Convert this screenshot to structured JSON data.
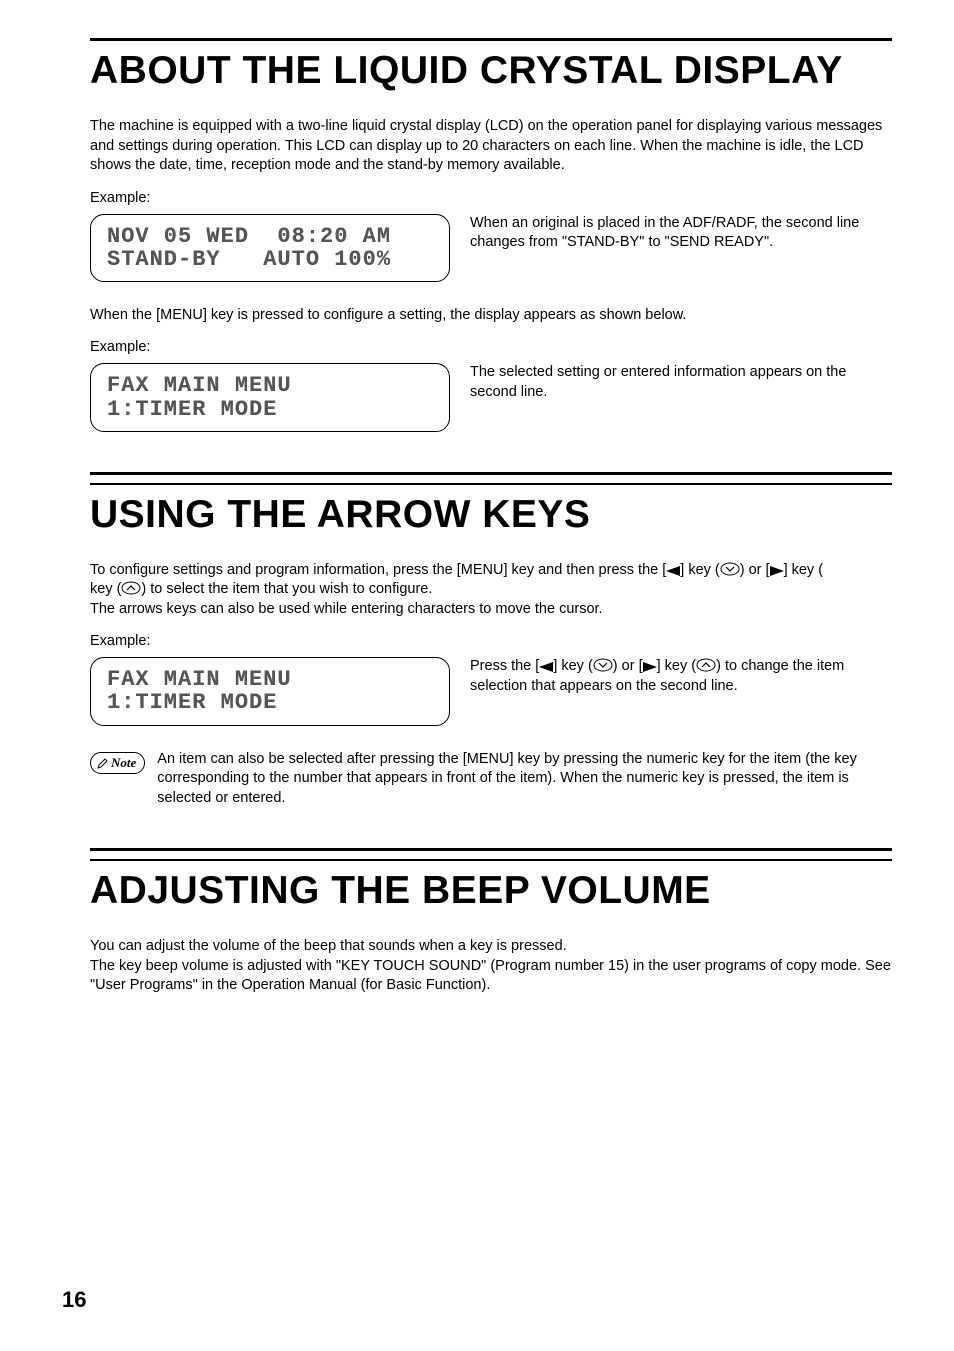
{
  "sections": [
    {
      "title": "ABOUT THE LIQUID CRYSTAL DISPLAY",
      "intro": "The machine is equipped with a two-line liquid crystal display (LCD) on the operation panel for displaying various messages and settings during operation. This LCD can display up to 20 characters on each line. When the machine is idle, the LCD shows the date, time, reception mode and the stand-by memory available.",
      "example_label": "Example:",
      "lcd1_line1": "NOV 05 WED  08:20 AM",
      "lcd1_line2": "STAND-BY   AUTO 100%",
      "lcd1_side": "When an original is placed in the ADF/RADF, the second line changes from \"STAND-BY\" to \"SEND READY\".",
      "mid_para": "When the [MENU] key is pressed to configure a setting, the display appears as shown below.",
      "lcd2_line1": "FAX MAIN MENU",
      "lcd2_line2": "1:TIMER MODE",
      "lcd2_side": "The selected setting or entered information appears on the second line."
    },
    {
      "title": "USING THE ARROW KEYS",
      "intro_pre": "To configure settings and program information, press the [MENU] key and then press the [",
      "intro_mid1": "] key (",
      "intro_mid2": ") or [",
      "intro_mid3": "] key (",
      "intro_post": ") to select the item that you wish to configure.",
      "intro_line2": "The arrows keys can also be used while entering characters to move the cursor.",
      "example_label": "Example:",
      "lcd_line1": "FAX MAIN MENU",
      "lcd_line2": "1:TIMER MODE",
      "side_pre": "Press the [",
      "side_mid1": "] key (",
      "side_mid2": ") or [",
      "side_mid3": "] key (",
      "side_post": ") to change the item selection that appears on the second line.",
      "note_label": "Note",
      "note_text": "An item can also be selected after pressing the [MENU] key by pressing the numeric key for the item (the key corresponding to the number that appears in front of the item). When the numeric key is pressed, the item is selected or entered."
    },
    {
      "title": "ADJUSTING THE BEEP VOLUME",
      "para1": "You can adjust the volume of the beep that sounds when a key is pressed.",
      "para2": "The key beep volume is adjusted with \"KEY TOUCH SOUND\" (Program number 15) in the user programs of copy mode. See \"User Programs\" in the Operation Manual (for Basic Function)."
    }
  ],
  "page_number": "16"
}
